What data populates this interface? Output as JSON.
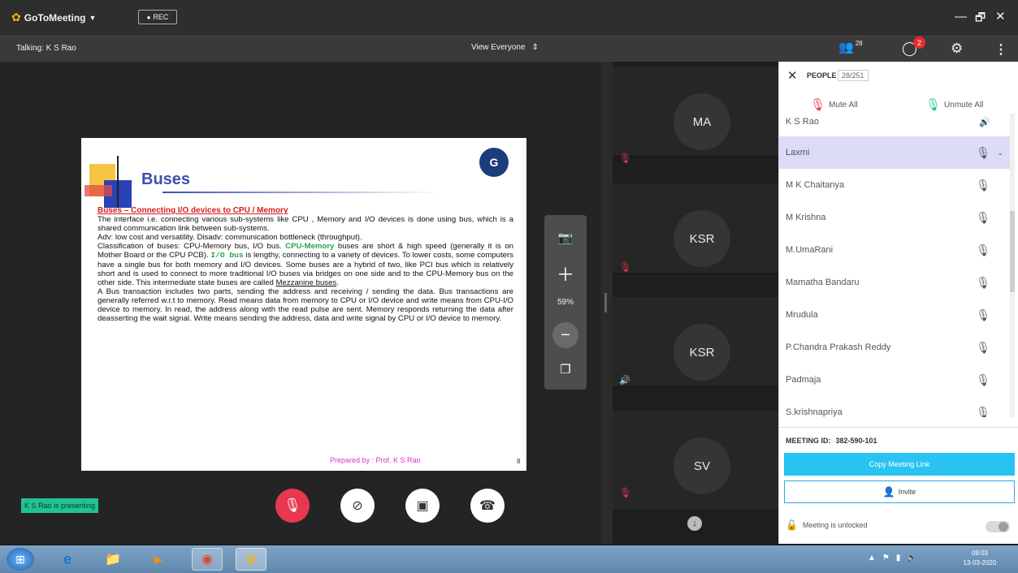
{
  "titlebar": {
    "app_name": "GoToMeeting",
    "rec_label": "REC",
    "window_min": "—",
    "window_max": "🗗",
    "window_close": "✕",
    "people_count": "28",
    "chat_badge": "2"
  },
  "subbar": {
    "talking": "Talking: K S Rao",
    "view": "View Everyone"
  },
  "slide": {
    "title": "Buses",
    "heading": "Buses – Connecting I/O devices to CPU / Memory",
    "p1": "The interface i.e. connecting various sub-systems like CPU , Memory and I/O devices is done using bus, which is a shared communication link between sub-systems.",
    "p2": "Adv: low cost and versatility. Disadv: communication bottleneck (throughput).",
    "p3a": "Classification of buses: CPU-Memory bus, I/O bus. ",
    "p3b": "CPU-Memory",
    "p3c": " buses are short & high speed (generally it is on Mother Board or the CPU PCB). ",
    "p3d": "I/O bus",
    "p3e": " is lengthy, connecting to a variety of devices. To lower costs, some computers have a single bus for both memory and I/O devices. Some buses are a hybrid of two, like PCI bus which is relatively short and is used to connect to more traditional I/O buses via bridges on one side and to the CPU-Memory bus on the other side. This intermediate state buses are called ",
    "p3f": "Mezzanine buses",
    "p3g": ".",
    "p4": "A Bus transaction includes two parts, sending the address and receiving / sending the data. Bus transactions are generally referred w.r.t to memory. Read means data from memory to CPU or I/O device and write means from CPU-I/O device to memory. In read, the address along with the read pulse are sent. Memory responds returning the data after deasserting the wait signal. Write means sending the address, data and write signal by CPU or I/O device to memory.",
    "footer": "Prepared by : Prof. K S Rao",
    "page": "8"
  },
  "zoom": {
    "level": "59%"
  },
  "presenting": "K S Rao is presenting",
  "tiles": [
    {
      "initials": "MA"
    },
    {
      "initials": "KSR"
    },
    {
      "initials": "KSR"
    },
    {
      "initials": "SV"
    }
  ],
  "people": {
    "title": "PEOPLE",
    "count": "28/251",
    "mute_all": "Mute All",
    "unmute_all": "Unmute All",
    "list": [
      "K S Rao",
      "Laxmi",
      "M K Chaitanya",
      "M Krishna",
      "M.UmaRani",
      "Mamatha Bandaru",
      "Mrudula",
      "P.Chandra Prakash Reddy",
      "Padmaja",
      "S.krishnapriya"
    ],
    "meeting_id_label": "MEETING ID:",
    "meeting_id": "382-590-101",
    "copy_link": "Copy Meeting Link",
    "invite": "Invite",
    "lock_label": "Meeting is unlocked"
  },
  "taskbar": {
    "time": "09:03",
    "date": "13-03-2020"
  },
  "colors": {
    "accent_blue": "#29a8ea",
    "mute_red": "#e8384f",
    "selected_row": "#dcdcf6"
  }
}
